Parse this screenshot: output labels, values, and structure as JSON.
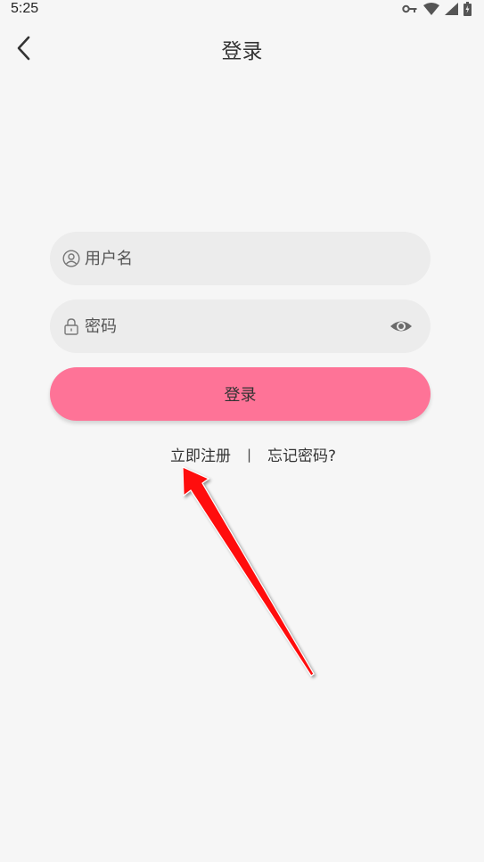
{
  "status_bar": {
    "time": "5:25"
  },
  "header": {
    "title": "登录"
  },
  "form": {
    "username_placeholder": "用户名",
    "username_value": "",
    "password_placeholder": "密码",
    "password_value": "",
    "login_label": "登录"
  },
  "links": {
    "register": "立即注册",
    "separator": "|",
    "forgot": "忘记密码?"
  },
  "colors": {
    "background": "#f6f6f6",
    "field_bg": "#ececec",
    "accent": "#fe7397",
    "annotation_arrow": "#ff0000"
  },
  "icons": [
    "key-icon",
    "wifi-icon",
    "signal-icon",
    "battery-icon",
    "back-arrow-icon",
    "user-icon",
    "lock-icon",
    "eye-icon"
  ]
}
